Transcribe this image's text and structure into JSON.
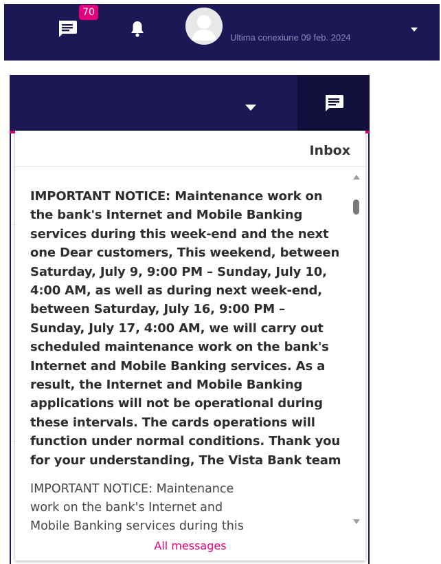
{
  "header": {
    "messages_badge": "70",
    "last_login_text": "Ultima conexiune 09 feb. 2024",
    "icons": {
      "messages": "chat-bubble-icon",
      "notifications": "bell-icon",
      "avatar": "user-avatar-icon",
      "menu": "caret-down-icon"
    }
  },
  "panel": {
    "title": "Inbox",
    "messages": [
      {
        "text": "IMPORTANT NOTICE: Maintenance work on the bank's Internet and Mobile Banking services during this week-end and the next one Dear customers, This weekend, between Saturday, July 9, 9:00 PM – Sunday, July 10, 4:00 AM, as well as during next week-end, between Saturday, July 16, 9:00 PM – Sunday, July 17, 4:00 AM, we will carry out scheduled maintenance work on the bank's Internet and Mobile Banking services. As a result, the Internet and Mobile Banking applications will not be operational during these intervals. The cards operations will function under normal conditions. Thank you for your understanding, The Vista Bank team",
        "unread": true
      },
      {
        "text": "IMPORTANT NOTICE: Maintenance work on the bank's Internet and Mobile Banking services during this",
        "unread": false
      }
    ],
    "all_messages_link": "All messages"
  },
  "colors": {
    "navy": "#1c1856",
    "navy_dark": "#120f3c",
    "accent_pink": "#e6007e"
  }
}
